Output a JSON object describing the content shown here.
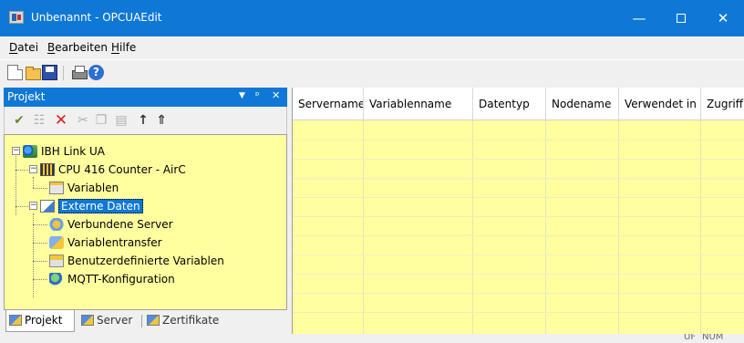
{
  "window": {
    "title": "Unbenannt - OPCUAEdit",
    "controls": {
      "minimize": "—",
      "close": "✕"
    }
  },
  "menu": [
    {
      "accel": "D",
      "rest": "atei"
    },
    {
      "accel": "B",
      "rest": "earbeiten"
    },
    {
      "accel": "H",
      "rest": "ilfe"
    }
  ],
  "toolbar": {
    "icons": [
      "new-icon",
      "open-icon",
      "save-icon",
      "print-icon",
      "help-icon"
    ],
    "help_glyph": "?"
  },
  "project_pane": {
    "title": "Projekt",
    "controls": {
      "dropdown": "▼",
      "pin": "ᵖ",
      "close": "✕"
    },
    "toolbar": {
      "icons": [
        "add-icon",
        "properties-icon",
        "delete-icon",
        "cut-icon",
        "copy-icon",
        "paste-icon",
        "move-up-icon",
        "move-top-icon"
      ],
      "glyphs": {
        "add": "✔",
        "properties": "☷",
        "delete": "✕",
        "cut": "✂",
        "copy": "❐",
        "paste": "▤",
        "up": "↑",
        "top": "⇑"
      }
    },
    "tree": {
      "root": "IBH Link UA",
      "cpu": "CPU 416 Counter - AirC",
      "variables": "Variablen",
      "external": "Externe Daten",
      "connected_servers": "Verbundene Server",
      "variable_transfer": "Variablentransfer",
      "user_variables": "Benutzerdefinierte Variablen",
      "mqtt": "MQTT-Konfiguration"
    },
    "tabs": [
      "Projekt",
      "Server",
      "Zertifikate"
    ],
    "active_tab": "Projekt"
  },
  "grid": {
    "columns": [
      "Servername",
      "Variablenname",
      "Datentyp",
      "Nodename",
      "Verwendet in",
      "Zugriff"
    ]
  },
  "status": {
    "indicators": [
      "UF",
      "NUM"
    ]
  },
  "colors": {
    "titlebar": "#0f78d7",
    "panel_background": "#ffffa0",
    "chrome": "#f0f0f0",
    "selection": "#0f78d7"
  }
}
